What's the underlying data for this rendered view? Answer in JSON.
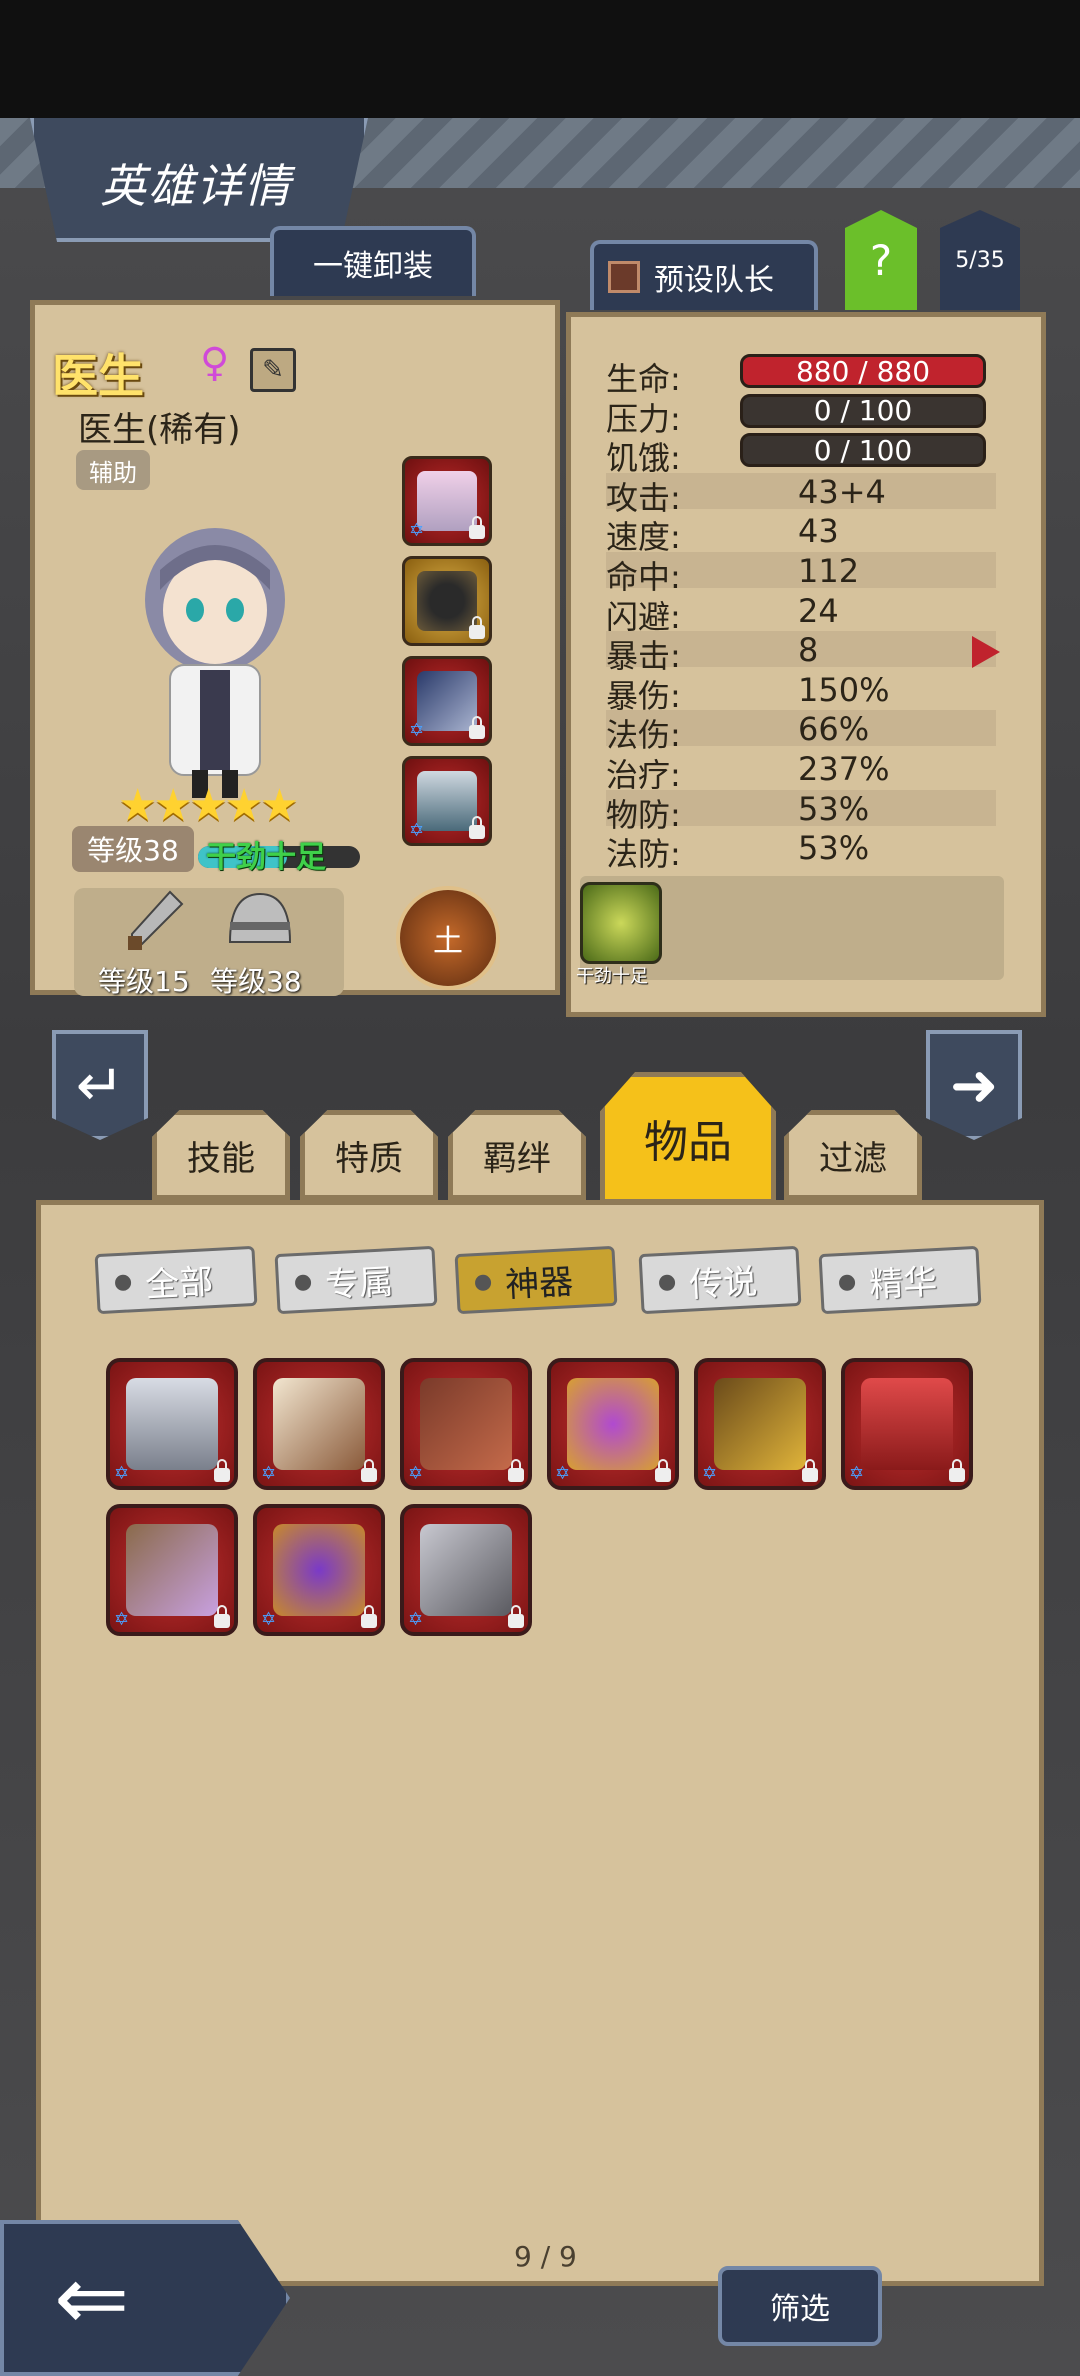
{
  "header": {
    "title": "英雄详情"
  },
  "toolbar": {
    "unequip_all": "一键卸装",
    "preset_leader": "预设队长",
    "help": "?",
    "roster_count": "5/35"
  },
  "hero": {
    "name": "医生",
    "gender_symbol": "♀",
    "subtitle": "医生(稀有)",
    "role": "辅助",
    "stars": "★★★★★",
    "level": "等级38",
    "mood": "干劲十足",
    "mood_level": 0.55,
    "weapon_level": "等级15",
    "armor_level": "等级38",
    "element": "土"
  },
  "stats": [
    {
      "label": "生命:",
      "value": "880 / 880",
      "type": "bar-red"
    },
    {
      "label": "压力:",
      "value": "0 / 100",
      "type": "bar-dark"
    },
    {
      "label": "饥饿:",
      "value": "0 / 100",
      "type": "bar-dark"
    },
    {
      "label": "攻击:",
      "value": "43+4"
    },
    {
      "label": "速度:",
      "value": "43"
    },
    {
      "label": "命中:",
      "value": "112"
    },
    {
      "label": "闪避:",
      "value": "24"
    },
    {
      "label": "暴击:",
      "value": "8"
    },
    {
      "label": "暴伤:",
      "value": "150%"
    },
    {
      "label": "法伤:",
      "value": "66%"
    },
    {
      "label": "治疗:",
      "value": "237%"
    },
    {
      "label": "物防:",
      "value": "53%"
    },
    {
      "label": "法防:",
      "value": "53%"
    }
  ],
  "trait": {
    "label": "干劲十足"
  },
  "tabs": [
    {
      "label": "技能"
    },
    {
      "label": "特质"
    },
    {
      "label": "羁绊"
    },
    {
      "label": "物品",
      "active": true
    },
    {
      "label": "过滤"
    }
  ],
  "filters": [
    {
      "label": "全部"
    },
    {
      "label": "专属"
    },
    {
      "label": "神器",
      "active": true
    },
    {
      "label": "传说"
    },
    {
      "label": "精华"
    }
  ],
  "items": [
    {
      "icon": "sword-shield-icon"
    },
    {
      "icon": "horn-icon"
    },
    {
      "icon": "crossbow-icon"
    },
    {
      "icon": "jeweled-ring-icon"
    },
    {
      "icon": "gold-gauntlet-icon"
    },
    {
      "icon": "red-belt-icon"
    },
    {
      "icon": "goggles-icon"
    },
    {
      "icon": "gold-ring-icon"
    },
    {
      "icon": "curved-blade-icon"
    }
  ],
  "pagination": "9 / 9",
  "footer": {
    "sort_label": "筛选",
    "back_icon": "back-arrow-icon"
  },
  "colors": {
    "accent": "#f5c11a",
    "bar_red": "#c0232d",
    "item_red": "#c42f2f"
  }
}
